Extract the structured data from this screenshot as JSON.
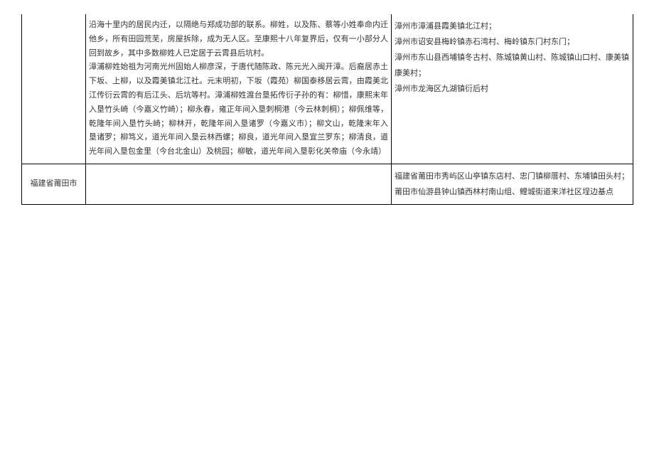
{
  "rows": [
    {
      "region": "",
      "history_p1": "沿海十里内的居民内迁，以隔绝与郑成功部的联系。柳姓，以及陈、蔡等小姓奉命内迁他乡，所有田园荒芜，房屋拆除，成为无人区。至康熙十八年复界后，仅有一小部分人回到故乡，其中多数柳姓人已定居于云霄县后坑村。",
      "history_p2": "漳浦柳姓始祖为河南光州固始人柳彦深，于唐代随陈政、陈元光入闽开漳。后裔居赤土下坂、上柳，以及霞美镇北江社。元末明初，下坂（霞苑）柳国泰移居云霄，由霞美北江传衍云霄的有后江头、后坑等村。漳浦柳姓渡台垦拓传衍子孙的有：柳惜，康熙末年入垦竹头崎（今嘉义竹崎）；柳永春，雍正年间入垦刺桐港（今云林刺桐）；柳佩维等，乾隆年间入垦竹头崎；柳林开，乾隆年间入垦诸罗（今嘉义市）；柳文山，乾隆末年入垦诸罗；柳笃义，道光年间入垦云林西螺；柳良，道光年间入垦宜兰罗东；柳清良，道光年间入垦包金里（今台北金山）及桃园；柳敏，道光年间入垦彰化关帝庙（今永靖）",
      "locations_l1": "漳州市漳浦县霞美镇北江村；",
      "locations_l2": "漳州市诏安县梅岭镇赤石湾村、梅岭镇东门村东门；",
      "locations_l3": "漳州市东山县西埔镇冬古村、陈城镇黄山村、陈城镇山口村、康美镇康美村；",
      "locations_l4": "漳州市龙海区九湖镇衍后村"
    },
    {
      "region": "福建省莆田市",
      "history": "",
      "locations_l1": "福建省莆田市秀屿区山亭镇东店村、忠门镇柳厝村、东埔镇田头村；",
      "locations_l2": "莆田市仙游县钟山镇西林村南山组、鲤城街道来洋社区埕边基点"
    }
  ]
}
